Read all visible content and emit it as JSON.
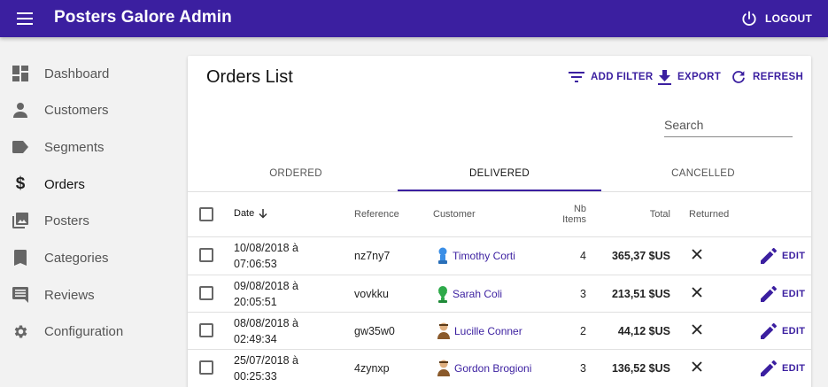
{
  "app": {
    "title": "Posters Galore Admin",
    "logout_label": "LOGOUT"
  },
  "sidebar": {
    "items": [
      {
        "label": "Dashboard",
        "icon": "dashboard-icon"
      },
      {
        "label": "Customers",
        "icon": "person-icon"
      },
      {
        "label": "Segments",
        "icon": "label-icon"
      },
      {
        "label": "Orders",
        "icon": "dollar-icon"
      },
      {
        "label": "Posters",
        "icon": "collections-icon"
      },
      {
        "label": "Categories",
        "icon": "bookmark-icon"
      },
      {
        "label": "Reviews",
        "icon": "comment-icon"
      },
      {
        "label": "Configuration",
        "icon": "settings-icon"
      }
    ]
  },
  "list": {
    "title": "Orders List",
    "add_filter_label": "ADD FILTER",
    "export_label": "EXPORT",
    "refresh_label": "REFRESH",
    "search_placeholder": "Search",
    "tabs": [
      {
        "label": "ORDERED"
      },
      {
        "label": "DELIVERED"
      },
      {
        "label": "CANCELLED"
      }
    ],
    "active_tab": "DELIVERED",
    "columns": {
      "date": "Date",
      "reference": "Reference",
      "customer": "Customer",
      "nb_items": "Nb Items",
      "total": "Total",
      "returned": "Returned"
    },
    "edit_label": "EDIT",
    "rows": [
      {
        "date": "10/08/2018 à 07:06:53",
        "reference": "nz7ny7",
        "customer": "Timothy Corti",
        "avatar_color": "#3a8ee6",
        "nb_items": "4",
        "total": "365,37 $US",
        "returned": false
      },
      {
        "date": "09/08/2018 à 20:05:51",
        "reference": "vovkku",
        "customer": "Sarah Coli",
        "avatar_color": "#2eaa4a",
        "nb_items": "3",
        "total": "213,51 $US",
        "returned": false
      },
      {
        "date": "08/08/2018 à 02:49:34",
        "reference": "gw35w0",
        "customer": "Lucille Conner",
        "avatar_color": "#8a5a2b",
        "nb_items": "2",
        "total": "44,12 $US",
        "returned": false
      },
      {
        "date": "25/07/2018 à 00:25:33",
        "reference": "4zynxp",
        "customer": "Gordon Brogioni",
        "avatar_color": "#8a5a2b",
        "nb_items": "3",
        "total": "136,52 $US",
        "returned": false
      }
    ]
  },
  "colors": {
    "primary": "#3b1fa0",
    "background": "#f2f2f2"
  }
}
